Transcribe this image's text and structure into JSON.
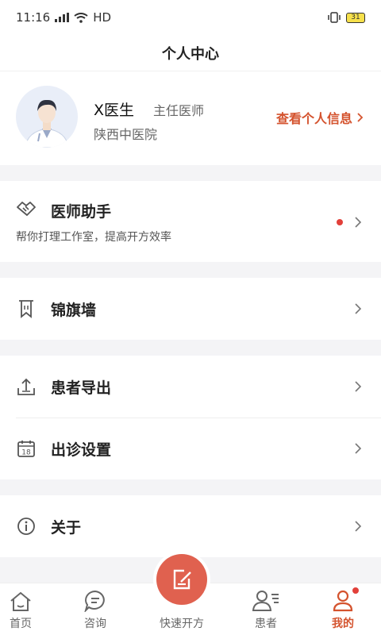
{
  "status_bar": {
    "time": "11:16",
    "network": "HD",
    "battery": "31"
  },
  "header": {
    "title": "个人中心"
  },
  "profile": {
    "name": "X医生",
    "title": "主任医师",
    "hospital": "陕西中医院",
    "link_label": "查看个人信息"
  },
  "assistant": {
    "title": "医师助手",
    "subtitle": "帮你打理工作室，提高开方效率",
    "icon": "handshake-icon",
    "has_notification": true
  },
  "menu": {
    "banner_wall": {
      "label": "锦旗墙",
      "icon": "bookmark-banner-icon"
    },
    "patient_export": {
      "label": "患者导出",
      "icon": "upload-export-icon"
    },
    "clinic_settings": {
      "label": "出诊设置",
      "icon": "calendar-icon"
    },
    "about": {
      "label": "关于",
      "icon": "info-icon"
    }
  },
  "tabbar": {
    "home": "首页",
    "consult": "咨询",
    "quick_prescribe": "快速开方",
    "patients": "患者",
    "mine": "我的",
    "active": "mine",
    "accent_color": "#d4532e"
  }
}
